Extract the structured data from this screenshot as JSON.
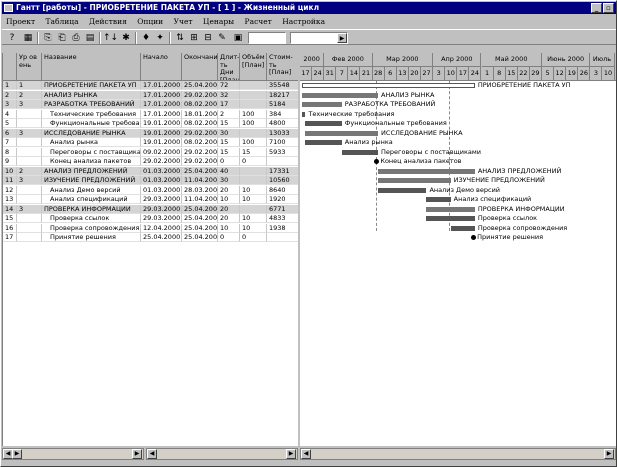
{
  "window": {
    "title": "Гантт [работы] - ПРИОБРЕТЕНИЕ ПАКЕТА УП - [ 1 ] - Жизненный цикл",
    "minimize": "_",
    "restore": "▫"
  },
  "menu": [
    "Проект",
    "Таблица",
    "Действия",
    "Опции",
    "Учет",
    "Ценары",
    "Расчет",
    "Настройка"
  ],
  "toolbar": {
    "icons": [
      "?",
      "▦",
      "⎘",
      "⎗",
      "⎙",
      "▤",
      "↑↓",
      "✱",
      "♦",
      "✦",
      "⇅",
      "⊞",
      "⊟",
      "✎"
    ]
  },
  "columns": [
    "Ур ов ень",
    "Название",
    "Начало",
    "Окончание",
    "Длит-ть Дни [План]",
    "Объём [План]",
    "Стоим-ть [План]"
  ],
  "rows": [
    {
      "n": "1",
      "lvl": "1",
      "name": "ПРИОБРЕТЕНИЕ ПАКЕТА УП",
      "start": "17.01.2000",
      "end": "25.04.2000",
      "dur": "72",
      "vol": "",
      "cost": "35548",
      "sum": true
    },
    {
      "n": "2",
      "lvl": "2",
      "name": "АНАЛИЗ РЫНКА",
      "start": "17.01.2000",
      "end": "29.02.2000",
      "dur": "32",
      "vol": "",
      "cost": "18217",
      "sum": true
    },
    {
      "n": "3",
      "lvl": "3",
      "name": "РАЗРАБОТКА ТРЕБОВАНИЙ",
      "start": "17.01.2000",
      "end": "08.02.2000",
      "dur": "17",
      "vol": "",
      "cost": "5184",
      "sum": true
    },
    {
      "n": "4",
      "lvl": "",
      "name": "Технические требования",
      "start": "17.01.2000",
      "end": "18.01.2000",
      "dur": "2",
      "vol": "100",
      "cost": "384",
      "sum": false
    },
    {
      "n": "5",
      "lvl": "",
      "name": "Функциональные требования",
      "start": "19.01.2000",
      "end": "08.02.2000",
      "dur": "15",
      "vol": "100",
      "cost": "4800",
      "sum": false
    },
    {
      "n": "6",
      "lvl": "3",
      "name": "ИССЛЕДОВАНИЕ РЫНКА",
      "start": "19.01.2000",
      "end": "29.02.2000",
      "dur": "30",
      "vol": "",
      "cost": "13033",
      "sum": true
    },
    {
      "n": "7",
      "lvl": "",
      "name": "Анализ рынка",
      "start": "19.01.2000",
      "end": "08.02.2000",
      "dur": "15",
      "vol": "100",
      "cost": "7100",
      "sum": false
    },
    {
      "n": "8",
      "lvl": "",
      "name": "Переговоры с поставщиками",
      "start": "09.02.2000",
      "end": "29.02.2000",
      "dur": "15",
      "vol": "15",
      "cost": "5933",
      "sum": false
    },
    {
      "n": "9",
      "lvl": "",
      "name": "Конец анализа пакетов",
      "start": "29.02.2000",
      "end": "29.02.2000",
      "dur": "0",
      "vol": "0",
      "cost": "",
      "sum": false
    },
    {
      "n": "10",
      "lvl": "2",
      "name": "АНАЛИЗ ПРЕДЛОЖЕНИЙ",
      "start": "01.03.2000",
      "end": "25.04.2000",
      "dur": "40",
      "vol": "",
      "cost": "17331",
      "sum": true
    },
    {
      "n": "11",
      "lvl": "3",
      "name": "ИЗУЧЕНИЕ ПРЕДЛОЖЕНИЙ",
      "start": "01.03.2000",
      "end": "11.04.2000",
      "dur": "30",
      "vol": "",
      "cost": "10560",
      "sum": true
    },
    {
      "n": "12",
      "lvl": "",
      "name": "Анализ Демо версий",
      "start": "01.03.2000",
      "end": "28.03.2000",
      "dur": "20",
      "vol": "10",
      "cost": "8640",
      "sum": false
    },
    {
      "n": "13",
      "lvl": "",
      "name": "Анализ спецификаций",
      "start": "29.03.2000",
      "end": "11.04.2000",
      "dur": "10",
      "vol": "10",
      "cost": "1920",
      "sum": false
    },
    {
      "n": "14",
      "lvl": "3",
      "name": "ПРОВЕРКА ИНФОРМАЦИИ",
      "start": "29.03.2000",
      "end": "25.04.2000",
      "dur": "20",
      "vol": "",
      "cost": "6771",
      "sum": true
    },
    {
      "n": "15",
      "lvl": "",
      "name": "Проверка ссылок",
      "start": "29.03.2000",
      "end": "25.04.2000",
      "dur": "20",
      "vol": "10",
      "cost": "4833",
      "sum": false
    },
    {
      "n": "16",
      "lvl": "",
      "name": "Проверка сопровождения",
      "start": "12.04.2000",
      "end": "25.04.2000",
      "dur": "10",
      "vol": "10",
      "cost": "1938",
      "sum": false
    },
    {
      "n": "17",
      "lvl": "",
      "name": "Принятие решения",
      "start": "25.04.2000",
      "end": "25.04.2000",
      "dur": "0",
      "vol": "0",
      "cost": "",
      "sum": false
    }
  ],
  "timescale": {
    "months": [
      "2000",
      "Фев 2000",
      "Мар 2000",
      "Апр 2000",
      "Май 2000",
      "Июнь 2000",
      "Июль"
    ],
    "weeks": [
      "17",
      "24",
      "31",
      "7",
      "14",
      "21",
      "28",
      "6",
      "13",
      "20",
      "27",
      "3",
      "10",
      "17",
      "24",
      "1",
      "8",
      "15",
      "22",
      "29",
      "5",
      "12",
      "19",
      "26",
      "3",
      "10"
    ]
  },
  "gantt": {
    "labels": [
      "ПРИОБРЕТЕНИЕ ПАКЕТА УП",
      "АНАЛИЗ РЫНКА",
      "РАЗРАБОТКА ТРЕБОВАНИЙ",
      "Технические требования",
      "Функциональные требования",
      "ИССЛЕДОВАНИЕ РЫНКА",
      "Анализ рынка",
      "Переговоры с поставщиками",
      "Конец анализа пакетов",
      "АНАЛИЗ ПРЕДЛОЖЕНИЙ",
      "ИЗУЧЕНИЕ ПРЕДЛОЖЕНИЙ",
      "Анализ Демо версий",
      "Анализ спецификаций",
      "ПРОВЕРКА ИНФОРМАЦИИ",
      "Проверка ссылок",
      "Проверка сопровождения",
      "Принятие решения"
    ]
  }
}
